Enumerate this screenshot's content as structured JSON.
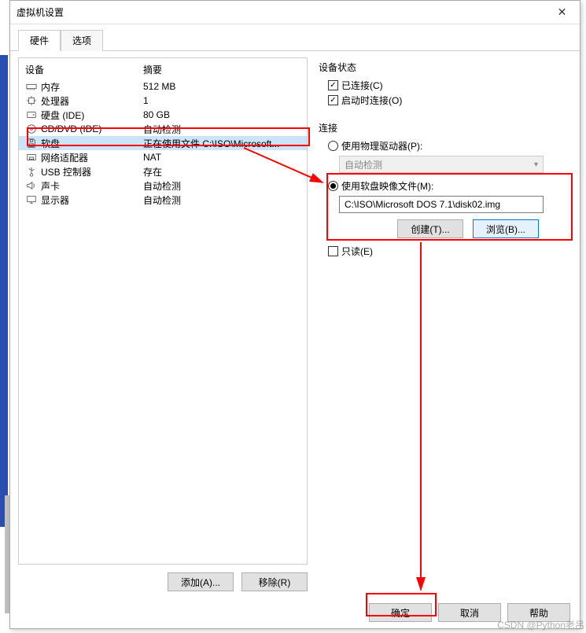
{
  "title": "虚拟机设置",
  "tabs": {
    "hardware": "硬件",
    "options": "选项"
  },
  "device_header": {
    "name": "设备",
    "summary": "摘要"
  },
  "devices": [
    {
      "icon": "memory-icon",
      "name": "内存",
      "summary": "512 MB"
    },
    {
      "icon": "cpu-icon",
      "name": "处理器",
      "summary": "1"
    },
    {
      "icon": "disk-icon",
      "name": "硬盘 (IDE)",
      "summary": "80 GB"
    },
    {
      "icon": "cd-icon",
      "name": "CD/DVD (IDE)",
      "summary": "自动检测"
    },
    {
      "icon": "floppy-icon",
      "name": "软盘",
      "summary": "正在使用文件 C:\\ISO\\Microsoft..."
    },
    {
      "icon": "nic-icon",
      "name": "网络适配器",
      "summary": "NAT"
    },
    {
      "icon": "usb-icon",
      "name": "USB 控制器",
      "summary": "存在"
    },
    {
      "icon": "sound-icon",
      "name": "声卡",
      "summary": "自动检测"
    },
    {
      "icon": "display-icon",
      "name": "显示器",
      "summary": "自动检测"
    }
  ],
  "selected_index": 4,
  "buttons": {
    "add": "添加(A)...",
    "remove": "移除(R)",
    "create": "创建(T)...",
    "browse": "浏览(B)...",
    "ok": "确定",
    "cancel": "取消",
    "help": "帮助"
  },
  "status": {
    "group": "设备状态",
    "connected": "已连接(C)",
    "connect_on": "启动时连接(O)"
  },
  "connection": {
    "group": "连接",
    "physical": "使用物理驱动器(P):",
    "autodetect": "自动检测",
    "use_image": "使用软盘映像文件(M):",
    "path": "C:\\ISO\\Microsoft DOS 7.1\\disk02.img",
    "readonly": "只读(E)"
  },
  "watermark": "CSDN @Python老吕"
}
